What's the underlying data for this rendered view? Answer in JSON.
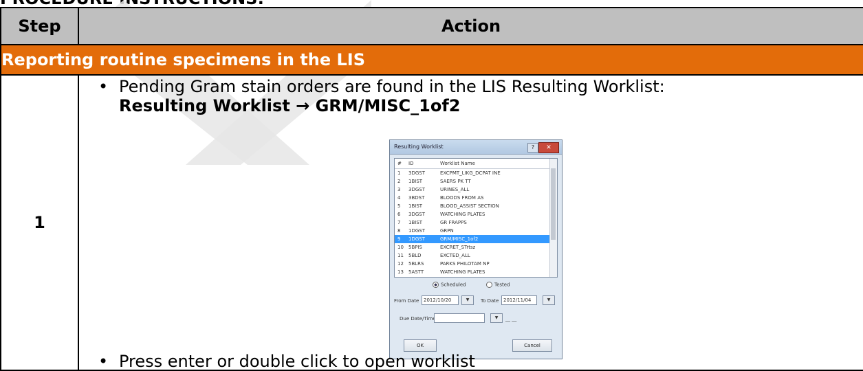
{
  "page_heading": "PROCEDURE INSTRUCTIONS:",
  "table": {
    "header": {
      "step": "Step",
      "action": "Action"
    },
    "section_title": "Reporting routine specimens in the LIS",
    "row1": {
      "step": "1",
      "bullet1": "Pending Gram stain orders are found in the LIS Resulting Worklist:",
      "path": "Resulting Worklist → GRM/MISC_1of2",
      "bullet2": "Press enter or double click to open worklist"
    }
  },
  "dialog": {
    "title": "Resulting Worklist",
    "help_label": "?",
    "close_label": "✕",
    "columns": {
      "n": "#",
      "id": "ID",
      "name": "Worklist Name"
    },
    "rows": [
      {
        "n": "1",
        "id": "3DGST",
        "name": "EXCPMT_LIKG_DCPAT INE"
      },
      {
        "n": "2",
        "id": "1BIST",
        "name": "SAERS PK TT"
      },
      {
        "n": "3",
        "id": "3DGST",
        "name": "URINES_ALL"
      },
      {
        "n": "4",
        "id": "3BDST",
        "name": "BLOODS FROM AS"
      },
      {
        "n": "5",
        "id": "1BIST",
        "name": "BLOOD_ASSIST SECTION"
      },
      {
        "n": "6",
        "id": "3DGST",
        "name": "WATCHING PLATES"
      },
      {
        "n": "7",
        "id": "1BIST",
        "name": "GR FRAPPS"
      },
      {
        "n": "8",
        "id": "1DGST",
        "name": "GRPN"
      },
      {
        "n": "9",
        "id": "1DGST",
        "name": "GRM/MISC_1of2",
        "selected": true
      },
      {
        "n": "10",
        "id": "5BPIS",
        "name": "EXCRET_STrtsz"
      },
      {
        "n": "11",
        "id": "5BLD",
        "name": "EXCTED_ALL"
      },
      {
        "n": "12",
        "id": "5BLRS",
        "name": "PARKS PHILOTAM NP"
      },
      {
        "n": "13",
        "id": "5ASTT",
        "name": "WATCHING PLATES"
      }
    ],
    "radio_scheduled": "Scheduled",
    "radio_tested": "Tested",
    "from_date_label": "From Date",
    "from_date_value": "2012/10/20",
    "to_date_label": "To Date",
    "to_date_value": "2012/11/04",
    "due_label": "Due Date/Time",
    "due_value": "",
    "ok_label": "OK",
    "cancel_label": "Cancel"
  }
}
